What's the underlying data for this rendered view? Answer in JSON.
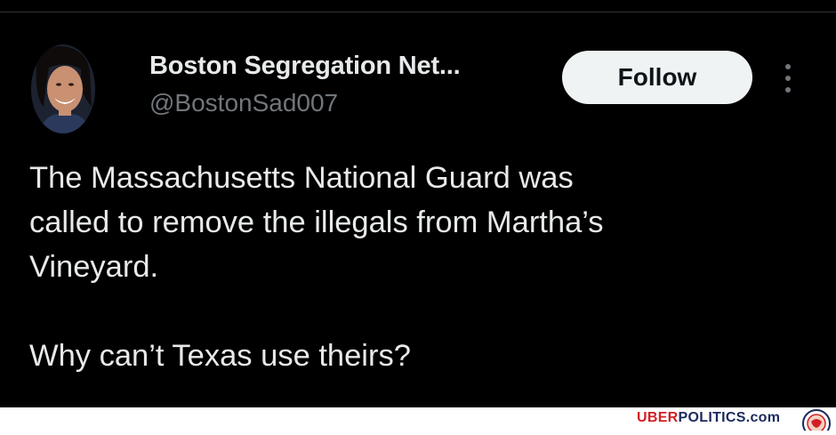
{
  "tweet": {
    "display_name": "Boston Segregation Net...",
    "handle": "@BostonSad007",
    "follow_label": "Follow",
    "body_lines": [
      "The Massachusetts National Guard was",
      "called to remove the illegals from Martha’s",
      "Vineyard.",
      "Why can’t Texas use theirs?"
    ]
  },
  "watermark": {
    "part1": "UBER",
    "part2": "POLITICS.com"
  },
  "icons": [
    "avatar",
    "more-options-icon",
    "uberpolitics-seal-icon"
  ],
  "colors": {
    "background": "#000000",
    "text_primary": "#e7e9ea",
    "text_secondary": "#71767b",
    "follow_button_bg": "#eff3f4",
    "follow_button_text": "#0f1419",
    "watermark_red": "#d21f26",
    "watermark_navy": "#1b2a5c"
  }
}
